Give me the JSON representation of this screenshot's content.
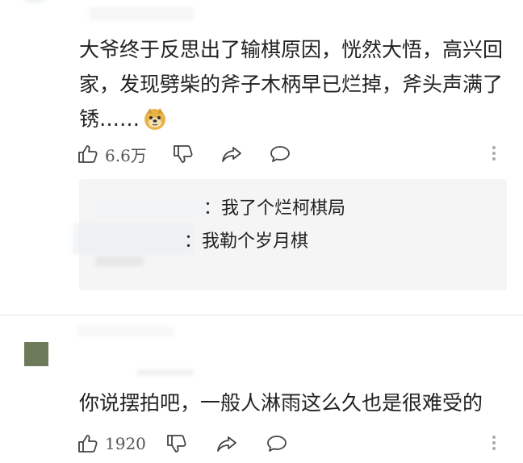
{
  "comment1": {
    "text": "大爷终于反思出了输棋原因，恍然大悟，高兴回家，发现劈柴的斧子木柄早已烂掉，斧头声满了锈……",
    "like_count": "6.6万",
    "emoji": "doge-emoji"
  },
  "reply": {
    "line1": "：我了个烂柯棋局",
    "line2": "：我勒个岁月棋"
  },
  "comment2": {
    "text": "你说摆拍吧，一般人淋雨这么久也是很难受的",
    "like_count": "1920"
  }
}
